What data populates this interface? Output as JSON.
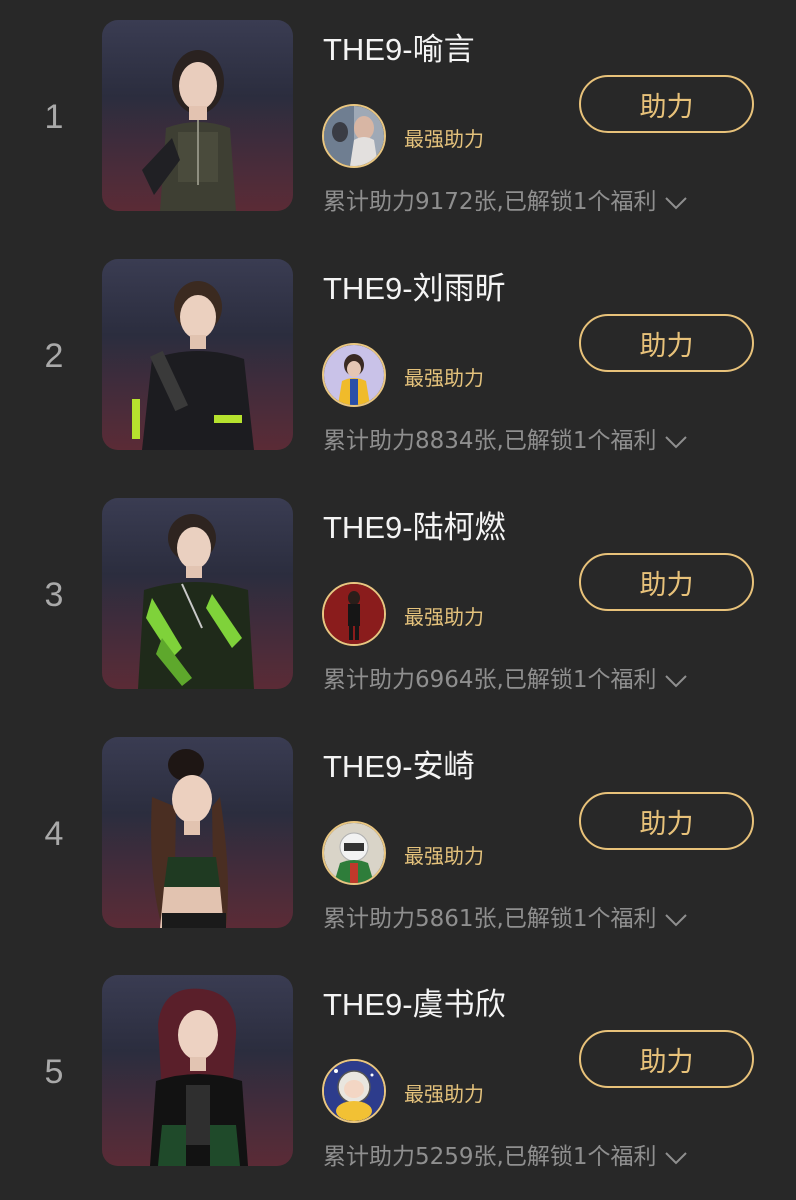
{
  "ranking": {
    "top_supporter_label": "最强助力",
    "button_label": "助力",
    "items": [
      {
        "rank": "1",
        "name": "THE9-喻言",
        "stats": "累计助力9172张,已解锁1个福利",
        "support_count": 9172,
        "unlocked_benefits": 1
      },
      {
        "rank": "2",
        "name": "THE9-刘雨昕",
        "stats": "累计助力8834张,已解锁1个福利",
        "support_count": 8834,
        "unlocked_benefits": 1
      },
      {
        "rank": "3",
        "name": "THE9-陆柯燃",
        "stats": "累计助力6964张,已解锁1个福利",
        "support_count": 6964,
        "unlocked_benefits": 1
      },
      {
        "rank": "4",
        "name": "THE9-安崎",
        "stats": "累计助力5861张,已解锁1个福利",
        "support_count": 5861,
        "unlocked_benefits": 1
      },
      {
        "rank": "5",
        "name": "THE9-虞书欣",
        "stats": "累计助力5259张,已解锁1个福利",
        "support_count": 5259,
        "unlocked_benefits": 1
      }
    ]
  },
  "colors": {
    "background": "#282828",
    "accent_gold": "#e8c27a",
    "name_text": "#f4f4f4",
    "secondary_text": "#8f8f8f",
    "rank_text": "#a9a9a9"
  },
  "icons": {
    "expand": "chevron-down-icon"
  }
}
